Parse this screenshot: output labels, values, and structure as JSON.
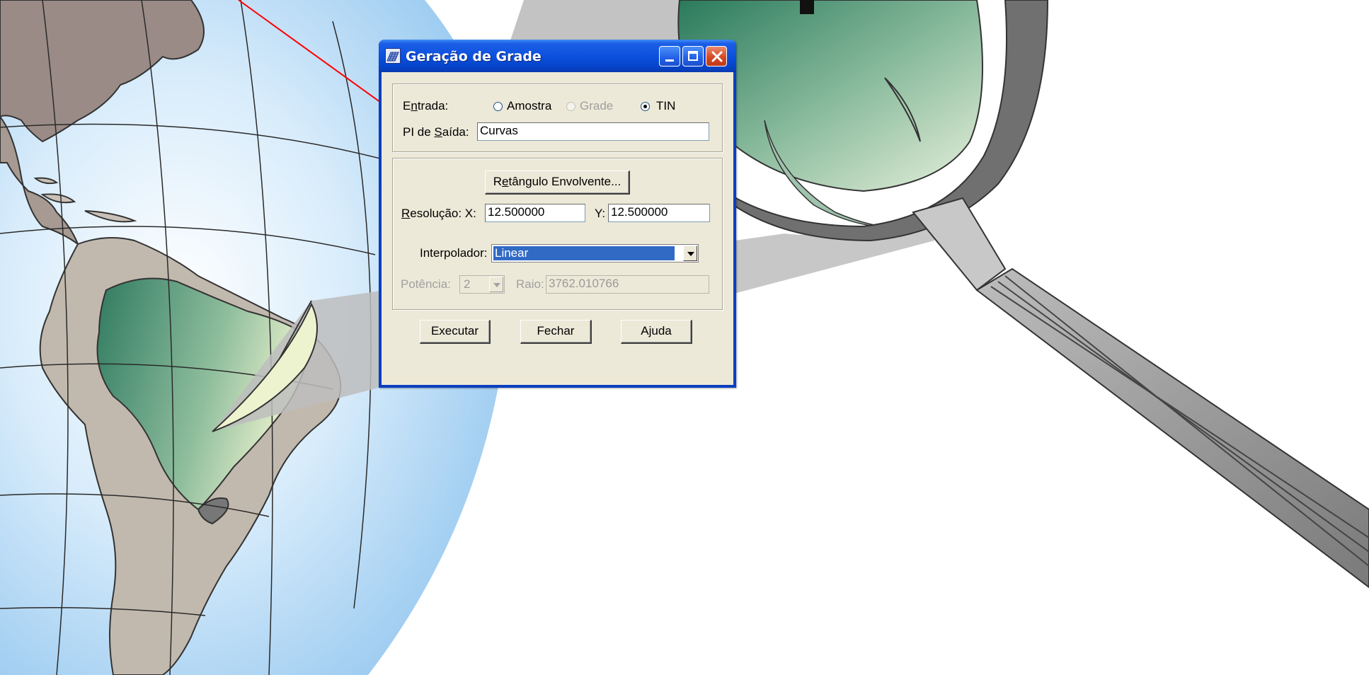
{
  "dialog": {
    "title": "Geração de Grade",
    "entrada": {
      "label_pre": "E",
      "label_u": "n",
      "label_post": "trada:",
      "options": [
        {
          "label": "Amostra",
          "checked": false,
          "enabled": true
        },
        {
          "label": "Grade",
          "checked": false,
          "enabled": false
        },
        {
          "label": "TIN",
          "checked": true,
          "enabled": true
        }
      ]
    },
    "pi_saida": {
      "label_pre": "PI de ",
      "label_u": "S",
      "label_post": "aída:",
      "value": "Curvas"
    },
    "retangulo_button": {
      "pre": "R",
      "u": "e",
      "post": "tângulo Envolvente..."
    },
    "resolucao": {
      "label_u": "R",
      "label_post": "esolução: X:",
      "x_value": "12.500000",
      "y_label": "Y:",
      "y_value": "12.500000"
    },
    "interpolador": {
      "label": "Interpolador:",
      "value": "Linear"
    },
    "potencia": {
      "label": "Potência:",
      "value": "2"
    },
    "raio": {
      "label": "Raio:",
      "value": "3762.010766"
    },
    "buttons": {
      "executar": "Executar",
      "fechar": "Fechar",
      "ajuda": "Ajuda"
    }
  },
  "colors": {
    "titlebar": "#0a4fdc",
    "close_button": "#d4461f",
    "dialog_face": "#ece9d8",
    "selection": "#316ac5",
    "annotation_arrow": "#ff0000"
  },
  "background": {
    "elements": [
      "globe-map",
      "south-america-map",
      "magnifying-glass",
      "red-annotation-arrow"
    ]
  }
}
